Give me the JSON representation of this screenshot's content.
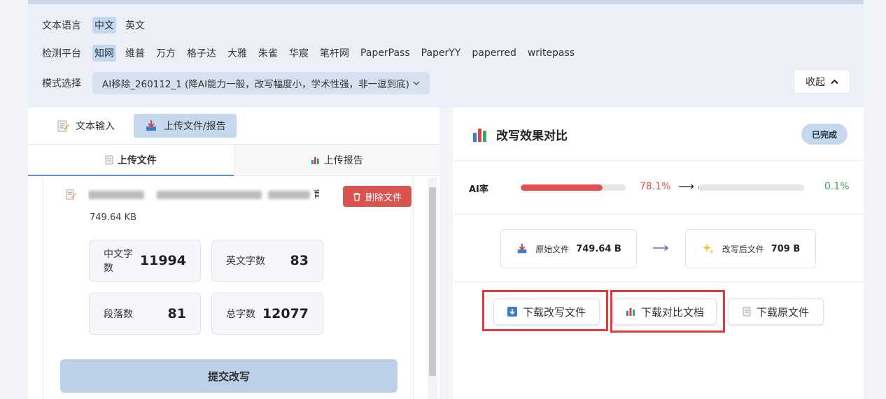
{
  "settings": {
    "language_label": "文本语言",
    "languages": [
      "中文",
      "英文"
    ],
    "platform_label": "检测平台",
    "platforms": [
      "知网",
      "维普",
      "万方",
      "格子达",
      "大雅",
      "朱雀",
      "华宸",
      "笔杆网",
      "PaperPass",
      "PaperYY",
      "paperred",
      "writepass"
    ],
    "mode_label": "模式选择",
    "mode_value": "AI移除_260112_1 (降AI能力一般，改写幅度小，学术性强，非一逗到底)",
    "collapse_label": "收起"
  },
  "input": {
    "tabs": [
      "文本输入",
      "上传文件/报告"
    ],
    "sub_tabs": [
      "上传文件",
      "上传报告"
    ],
    "file": {
      "name_suffix": "育...",
      "size": "749.64 KB",
      "delete_label": "删除文件"
    },
    "stats": [
      {
        "label": "中文字数",
        "value": "11994"
      },
      {
        "label": "英文字数",
        "value": "83"
      },
      {
        "label": "段落数",
        "value": "81"
      },
      {
        "label": "总字数",
        "value": "12077"
      }
    ],
    "submit_label": "提交改写"
  },
  "result": {
    "title": "改写效果对比",
    "status": "已完成",
    "ai_label": "AI率",
    "ai_before": "78.1%",
    "ai_before_fraction": 0.781,
    "ai_after": "0.1%",
    "ai_after_fraction": 0.001,
    "arrow": "⟶",
    "original_label": "原始文件",
    "original_size": "749.64 B",
    "rewritten_label": "改写后文件",
    "rewritten_size": "709 B",
    "downloads": [
      "下载改写文件",
      "下载对比文档",
      "下载原文件"
    ]
  },
  "colors": {
    "accent": "#c6d8ee",
    "danger": "#d9534f",
    "bar_before": "#e05252",
    "text_before": "#e05252",
    "text_after": "#3aa76d",
    "highlight": "#e03b3b"
  }
}
